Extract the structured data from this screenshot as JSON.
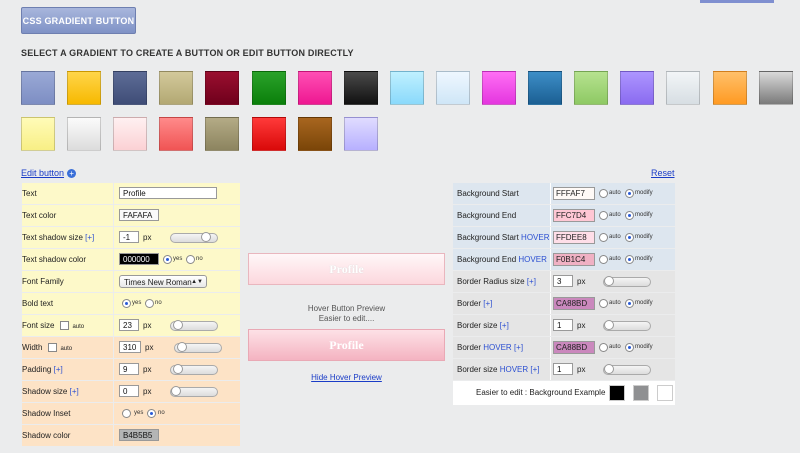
{
  "header": {
    "title_button": "CSS GRADIENT BUTTON",
    "heading": "SELECT A GRADIENT TO CREATE A BUTTON OR EDIT BUTTON DIRECTLY"
  },
  "swatches": [
    [
      "#9aa9d6",
      "#7d8ec3"
    ],
    [
      "#ffd54a",
      "#f7b900"
    ],
    [
      "#5d6c97",
      "#3f4d77"
    ],
    [
      "#d3c99b",
      "#b3a873"
    ],
    [
      "#9a0f2f",
      "#6f001c"
    ],
    [
      "#2aa22a",
      "#0b7f0b"
    ],
    [
      "#ff4fb4",
      "#ee1791"
    ],
    [
      "#4a4a4a",
      "#111111"
    ],
    [
      "#bff0ff",
      "#8ad9fb"
    ],
    [
      "#eef7ff",
      "#cfe6f7"
    ],
    [
      "#ff6ef4",
      "#e436df"
    ],
    [
      "#3d8ec7",
      "#1b5f93"
    ],
    [
      "#b6e28f",
      "#8ec964"
    ],
    [
      "#ad95ff",
      "#8a6bf0"
    ],
    [
      "#f2f5f7",
      "#d7dee3"
    ],
    [
      "#ffc06a",
      "#ff9a22"
    ],
    [
      "#d9d9d9",
      "#7a7a7a"
    ],
    [
      "#fffbb8",
      "#f8ef85"
    ],
    [
      "#fbfbfb",
      "#dcdcdc"
    ],
    [
      "#fff0f1",
      "#fbd1d4"
    ],
    [
      "#ff8a8a",
      "#f05454"
    ],
    [
      "#b4ab86",
      "#8c845f"
    ],
    [
      "#ff3a3a",
      "#d90909"
    ],
    [
      "#a8661f",
      "#7a4508"
    ],
    [
      "#e0dcff",
      "#b7b0ff"
    ]
  ],
  "links": {
    "edit_button": "Edit button",
    "edit_plus": "+",
    "reset": "Reset",
    "hide_hover": "Hide Hover Preview"
  },
  "left": {
    "text": {
      "label": "Text",
      "value": "Profile"
    },
    "text_color": {
      "label": "Text color",
      "value": "FAFAFA"
    },
    "text_shadow_size": {
      "label": "Text shadow size",
      "plus": "[+]",
      "value": "-1",
      "unit": "px",
      "slider_pct": 0.8
    },
    "text_shadow_color": {
      "label": "Text shadow color",
      "value": "000000",
      "yes": "yes",
      "no": "no"
    },
    "font_family": {
      "label": "Font Family",
      "value": "Times New Roman"
    },
    "bold_text": {
      "label": "Bold text",
      "yes": "yes",
      "no": "no"
    },
    "font_size": {
      "label": "Font size",
      "auto": "auto",
      "value": "23",
      "unit": "px",
      "slider_pct": 0.1
    },
    "width": {
      "label": "Width",
      "auto": "auto",
      "value": "310",
      "unit": "px",
      "slider_pct": 0.1
    },
    "padding": {
      "label": "Padding",
      "plus": "[+]",
      "value": "9",
      "unit": "px",
      "slider_pct": 0.1
    },
    "shadow_size": {
      "label": "Shadow size",
      "plus": "[+]",
      "value": "0",
      "unit": "px",
      "slider_pct": 0.0
    },
    "shadow_inset": {
      "label": "Shadow Inset",
      "yes": "yes",
      "no": "no"
    },
    "shadow_color": {
      "label": "Shadow color",
      "value": "B4B5B5"
    }
  },
  "preview": {
    "normal_label": "Profile",
    "caption_line1": "Hover Button Preview",
    "caption_line2": "Easier to edit....",
    "hover_label": "Profile"
  },
  "right": {
    "bg_start": {
      "label": "Background Start",
      "value": "FFFAF7",
      "color": "#fffaf7",
      "auto": "auto",
      "modify": "modify"
    },
    "bg_end": {
      "label": "Background End",
      "value": "FFC7D4",
      "color": "#ffc7d4",
      "auto": "auto",
      "modify": "modify"
    },
    "bg_start_hover": {
      "label": "Background Start",
      "hover": "HOVER",
      "value": "FFDEE8",
      "color": "#ffdee8",
      "auto": "auto",
      "modify": "modify"
    },
    "bg_end_hover": {
      "label": "Background End",
      "hover": "HOVER",
      "value": "F0B1C4",
      "color": "#f0b1c4",
      "auto": "auto",
      "modify": "modify"
    },
    "border_radius": {
      "label": "Border Radius size",
      "plus": "[+]",
      "value": "3",
      "unit": "px"
    },
    "border": {
      "label": "Border",
      "plus": "[+]",
      "value": "CA88BD",
      "color": "#ca88bd",
      "auto": "auto",
      "modify": "modify"
    },
    "border_size": {
      "label": "Border size",
      "plus": "[+]",
      "value": "1",
      "unit": "px"
    },
    "border_hover": {
      "label": "Border",
      "hover": "HOVER",
      "plus": "[+]",
      "value": "CA88BD",
      "color": "#ca88bd",
      "auto": "auto",
      "modify": "modify"
    },
    "border_size_hover": {
      "label": "Border size",
      "hover": "HOVER",
      "plus": "[+]",
      "value": "1",
      "unit": "px"
    },
    "example": {
      "label": "Easier to edit : Background Example",
      "colors": [
        "#000000",
        "#8f9092",
        "#ffffff"
      ]
    }
  }
}
